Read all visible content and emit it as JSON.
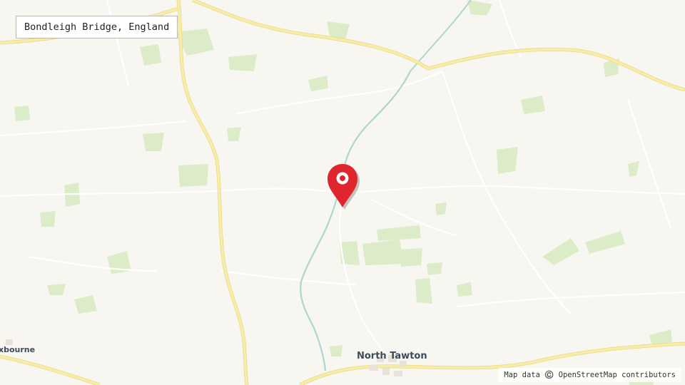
{
  "location": {
    "title": "Bondleigh Bridge, England"
  },
  "places": {
    "town": "North Tawton",
    "village_partial": "xbourne"
  },
  "attribution": "Map data ©️ OpenStreetMap contributors",
  "colors": {
    "background": "#f8f6f1",
    "woodland": "#dcecc8",
    "main_road": "#f7eda6",
    "main_road_edge": "#ecd98c",
    "minor_road": "#ffffff",
    "river": "#aed6cc",
    "marker": "#e0262d",
    "place_label": "#3d4b5c"
  },
  "marker": {
    "icon": "map-pin-icon"
  }
}
